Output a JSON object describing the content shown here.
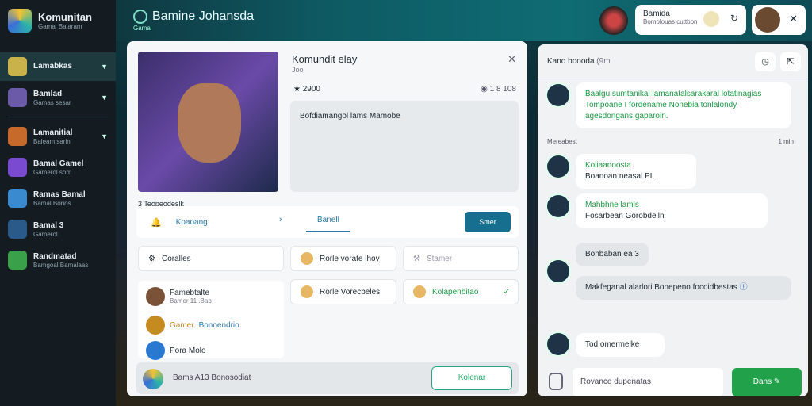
{
  "app": {
    "brand": "Komunitan",
    "brand_sub": "Gamal Balaram"
  },
  "sidebar": {
    "items": [
      {
        "label": "Lamabkas",
        "sub": ""
      },
      {
        "label": "Bamlad",
        "sub": "Gamas sesar"
      },
      {
        "label": "Lamanitial",
        "sub": "Baleam sarin"
      },
      {
        "label": "Bamal Gamel",
        "sub": "Gamerol sorri"
      },
      {
        "label": "Ramas Bamal",
        "sub": "Bamal Borios"
      },
      {
        "label": "Bamal 3",
        "sub": "Gamerol"
      },
      {
        "label": "Randmatad",
        "sub": "Bamgoal Bamalaas"
      }
    ]
  },
  "topbar": {
    "title": "Bamine Johansda",
    "subtitle": "Gamal",
    "card_a": "Bamida",
    "card_b": "Bomolouas cuttbon"
  },
  "detail": {
    "title": "Komundit elay",
    "sub": "Joo",
    "coin_left": "2900",
    "coin_right": "1  8 108",
    "desc": "Bofdiamangol lams Mamobe",
    "section_label": "3 Teopeodeslk",
    "tab1": "Koaoang",
    "tab2": "Banell",
    "cta": "Smer"
  },
  "options": [
    {
      "label": "Coralles",
      "style": "plain"
    },
    {
      "label": "Rorle vorate lhoy",
      "style": "plain"
    },
    {
      "label": "Stamer",
      "style": "dim"
    },
    {
      "label": "Rorle Vorecbeles",
      "style": "plain"
    },
    {
      "label": "Kolapenbitao",
      "style": "g"
    }
  ],
  "people": [
    {
      "name": "Famebtalte",
      "sub": "Bamer 11 .Bab"
    },
    {
      "name": "Gamer",
      "sub": "Bonoendrio"
    },
    {
      "name": "Pora Molo",
      "sub": ""
    }
  ],
  "footer": {
    "text": "Bams A13 Bonosodiat",
    "button": "Kolenar"
  },
  "chat": {
    "title": "Kano boooda",
    "time": "(9m",
    "m1": "Baalgu sumtanikal lamanatalsarakaral lotatinagias Tompoane I fordename Nonebia tonlalondy agesdongans gaparoin.",
    "label": "Mereabest",
    "label_time": "1 min",
    "m2": "Koliaanoosta",
    "m2b": "Boanoan neasal PL",
    "m3": "Mahbhne lamls",
    "m3b": "Fosarbean Gorobdeiln",
    "m4": "Bonbaban ea 3",
    "m5": "Makfeganal alarlori Bonepeno focoidbestas",
    "m6": "Tod omermelke",
    "input": "Rovance dupenatas",
    "send": "Dans"
  },
  "colors": {
    "accent": "#2a79a8",
    "green": "#21a24a"
  }
}
